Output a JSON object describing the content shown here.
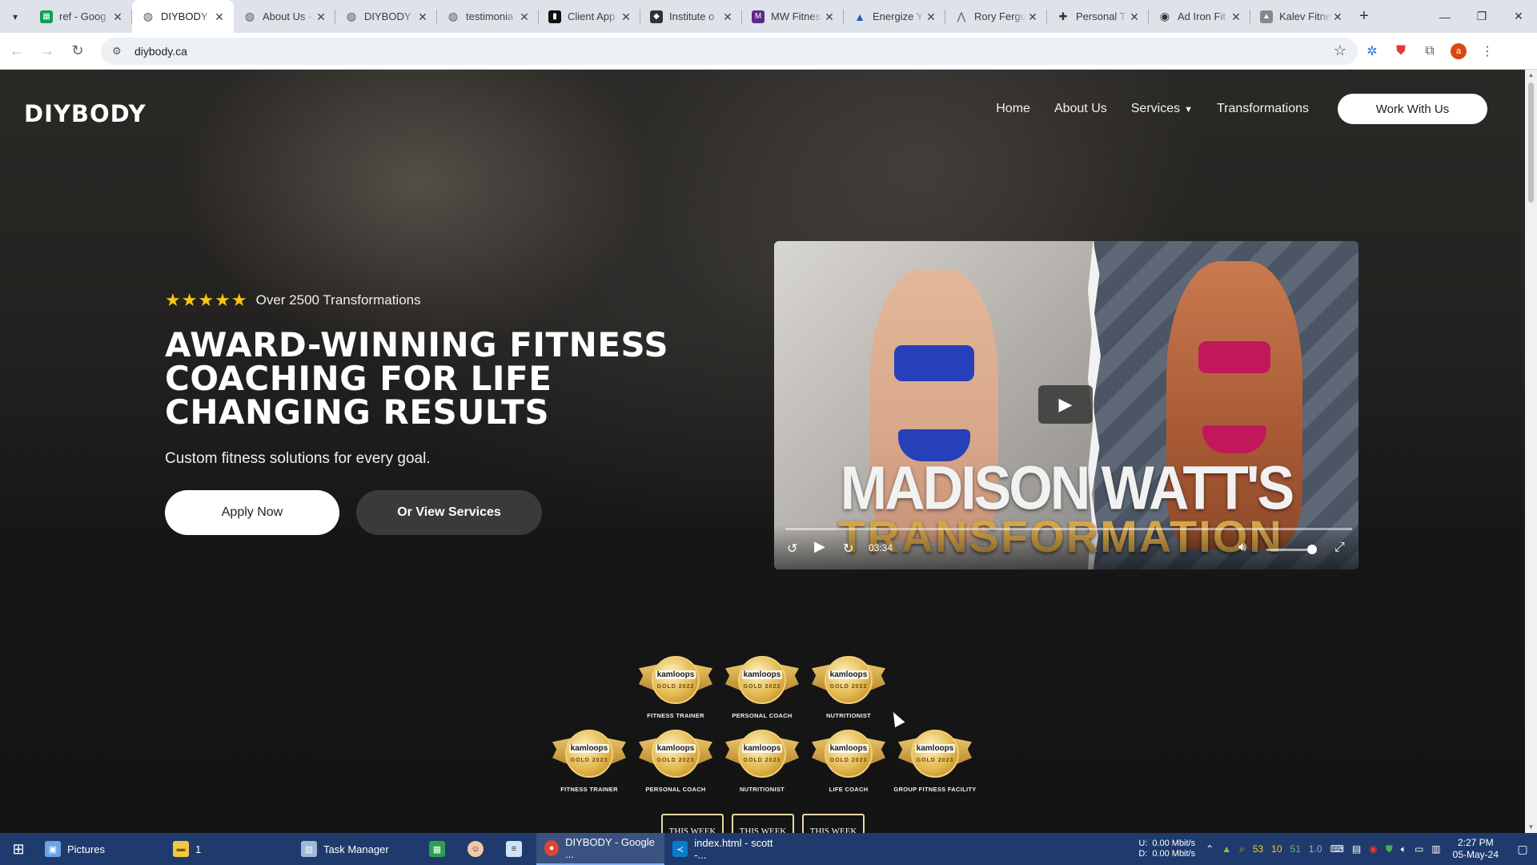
{
  "browser": {
    "tabs": [
      {
        "title": "ref - Goog",
        "favicon": "sheets-icon",
        "color": "#0f9d58"
      },
      {
        "title": "DIYBODY",
        "favicon": "globe-icon",
        "color": "#666666",
        "active": true
      },
      {
        "title": "About Us -",
        "favicon": "globe-icon",
        "color": "#666666"
      },
      {
        "title": "DIYBODY (",
        "favicon": "globe-icon",
        "color": "#666666"
      },
      {
        "title": "testimonia",
        "favicon": "globe-icon",
        "color": "#666666"
      },
      {
        "title": "Client App",
        "favicon": "app-icon",
        "color": "#111111"
      },
      {
        "title": "Institute o",
        "favicon": "shield-icon",
        "color": "#333333"
      },
      {
        "title": "MW Fitnes",
        "favicon": "mw-icon",
        "color": "#5b2a86"
      },
      {
        "title": "Energize Y",
        "favicon": "energize-icon",
        "color": "#1e5bd7"
      },
      {
        "title": "Rory Fergu",
        "favicon": "rf-icon",
        "color": "#555555"
      },
      {
        "title": "Personal T",
        "favicon": "dumbbell-icon",
        "color": "#333333"
      },
      {
        "title": "Ad Iron Fit",
        "favicon": "ironfit-icon",
        "color": "#333333"
      },
      {
        "title": "Kalev Fitne",
        "favicon": "kalev-icon",
        "color": "#888888"
      }
    ],
    "url": "diybody.ca",
    "profile_initial": "a"
  },
  "site": {
    "logo": "DIYBODY",
    "nav": {
      "home": "Home",
      "about": "About Us",
      "services": "Services",
      "transformations": "Transformations",
      "cta": "Work With Us"
    },
    "hero": {
      "stars": "★★★★★",
      "rating_text": "Over 2500 Transformations",
      "headline_line1": "AWARD-WINNING FITNESS",
      "headline_line2": "COACHING FOR LIFE",
      "headline_line3": "CHANGING RESULTS",
      "subhead": "Custom fitness solutions for every goal.",
      "primary_button": "Apply Now",
      "secondary_button": "Or View Services"
    },
    "video": {
      "title_line1": "MADISON WATT'S",
      "title_line2": "TRANSFORMATION",
      "duration": "03:34"
    },
    "awards": {
      "brand": "kamloops",
      "row1": [
        {
          "year": "GOLD 2022",
          "caption": "FITNESS TRAINER"
        },
        {
          "year": "GOLD 2022",
          "caption": "PERSONAL COACH"
        },
        {
          "year": "GOLD 2022",
          "caption": "NUTRITIONIST"
        }
      ],
      "row2": [
        {
          "year": "GOLD 2023",
          "caption": "FITNESS TRAINER"
        },
        {
          "year": "GOLD 2023",
          "caption": "PERSONAL COACH"
        },
        {
          "year": "GOLD 2023",
          "caption": "NUTRITIONIST"
        },
        {
          "year": "GOLD 2023",
          "caption": "LIFE COACH"
        },
        {
          "year": "GOLD 2023",
          "caption": "GROUP FITNESS FACILITY"
        }
      ],
      "this_week": [
        "THIS WEEK",
        "THIS WEEK",
        "THIS WEEK"
      ]
    }
  },
  "taskbar": {
    "items": [
      {
        "label": "Pictures",
        "icon": "pictures-icon"
      },
      {
        "label": "1",
        "icon": "folder-icon"
      },
      {
        "label": "Task Manager",
        "icon": "task-manager-icon"
      },
      {
        "label": "",
        "icon": "spreadsheet-icon"
      },
      {
        "label": "",
        "icon": "app-face-icon"
      },
      {
        "label": "",
        "icon": "notepad-icon"
      },
      {
        "label": "DIYBODY - Google ...",
        "icon": "chrome-icon",
        "active": true
      },
      {
        "label": "index.html - scott -...",
        "icon": "vscode-icon"
      }
    ],
    "net_up_label": "U:",
    "net_up": "0.00 Mbit/s",
    "net_down_label": "D:",
    "net_down": "0.00 Mbit/s",
    "tray_numbers": [
      "53",
      "10",
      "51",
      "1.0"
    ],
    "time": "2:27 PM",
    "date": "05-May-24"
  }
}
